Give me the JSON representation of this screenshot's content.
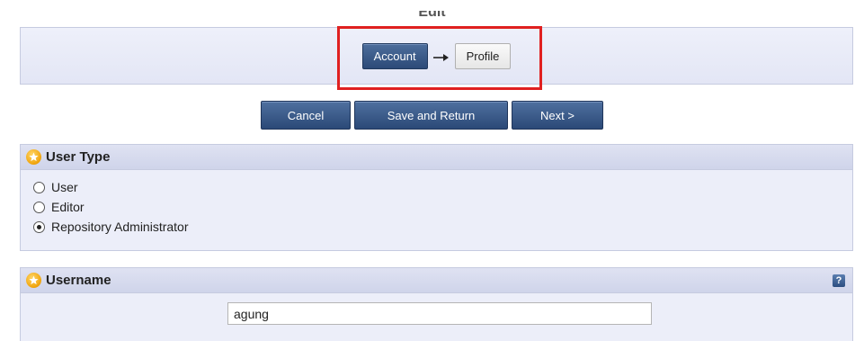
{
  "header": {
    "title": "Edit"
  },
  "wizard": {
    "stages": [
      "Account",
      "Profile"
    ],
    "active_stage": "Account"
  },
  "actions": {
    "cancel": "Cancel",
    "save_return": "Save and Return",
    "next": "Next >"
  },
  "user_type": {
    "title": "User Type",
    "options": [
      "User",
      "Editor",
      "Repository Administrator"
    ],
    "selected": "Repository Administrator"
  },
  "username": {
    "title": "Username",
    "value": "agung",
    "help_icon": "?"
  },
  "colors": {
    "highlight": "#e02020",
    "button": "#2c4a78",
    "panel": "#eceef9"
  }
}
